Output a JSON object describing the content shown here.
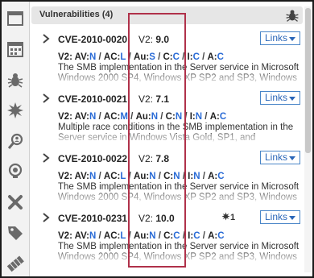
{
  "header": {
    "title": "Vulnerabilities (4)",
    "icon": "bug-icon"
  },
  "sidebar": {
    "items": [
      {
        "icon": "window-icon"
      },
      {
        "icon": "calendar-icon"
      },
      {
        "icon": "bug-icon"
      },
      {
        "icon": "burst-icon"
      },
      {
        "icon": "magnifier-person-icon"
      },
      {
        "icon": "lightbulb-icon"
      },
      {
        "icon": "crossed-tools-icon"
      },
      {
        "icon": "tag-icon"
      },
      {
        "icon": "ticket-icon"
      }
    ]
  },
  "cards": [
    {
      "cve": "CVE-2010-0020",
      "v2_label": "V2:",
      "score": "9.0",
      "exploit": "",
      "links_label": "Links",
      "vector": [
        {
          "k": "AV:",
          "v": "N"
        },
        {
          "k": "AC:",
          "v": "L"
        },
        {
          "k": "Au:",
          "v": "S"
        },
        {
          "k": "C:",
          "v": "C"
        },
        {
          "k": "I:",
          "v": "C"
        },
        {
          "k": "A:",
          "v": "C"
        }
      ],
      "desc": "The SMB implementation in the Server service in Microsoft Windows 2000 SP4, Windows XP SP2 and SP3, Windows"
    },
    {
      "cve": "CVE-2010-0021",
      "v2_label": "V2:",
      "score": "7.1",
      "exploit": "",
      "links_label": "Links",
      "vector": [
        {
          "k": "AV:",
          "v": "N"
        },
        {
          "k": "AC:",
          "v": "M"
        },
        {
          "k": "Au:",
          "v": "N"
        },
        {
          "k": "C:",
          "v": "N"
        },
        {
          "k": "I:",
          "v": "N"
        },
        {
          "k": "A:",
          "v": "C"
        }
      ],
      "desc": "Multiple race conditions in the SMB implementation in the Server service in Windows Vista Gold, SP1, and"
    },
    {
      "cve": "CVE-2010-0022",
      "v2_label": "V2:",
      "score": "7.8",
      "exploit": "",
      "links_label": "Links",
      "vector": [
        {
          "k": "AV:",
          "v": "N"
        },
        {
          "k": "AC:",
          "v": "L"
        },
        {
          "k": "Au:",
          "v": "N"
        },
        {
          "k": "C:",
          "v": "N"
        },
        {
          "k": "I:",
          "v": "N"
        },
        {
          "k": "A:",
          "v": "C"
        }
      ],
      "desc": "The SMB implementation in the Server service in Microsoft Windows 2000 SP4, Windows XP SP2 and SP3, Windows"
    },
    {
      "cve": "CVE-2010-0231",
      "v2_label": "V2:",
      "score": "10.0",
      "exploit": "1",
      "links_label": "Links",
      "vector": [
        {
          "k": "AV:",
          "v": "N"
        },
        {
          "k": "AC:",
          "v": "L"
        },
        {
          "k": "Au:",
          "v": "N"
        },
        {
          "k": "C:",
          "v": "C"
        },
        {
          "k": "I:",
          "v": "C"
        },
        {
          "k": "A:",
          "v": "C"
        }
      ],
      "desc": "The SMB implementation in the Server service in Microsoft Windows 2000 SP4, Windows XP SP2 and SP3, Windows"
    }
  ]
}
